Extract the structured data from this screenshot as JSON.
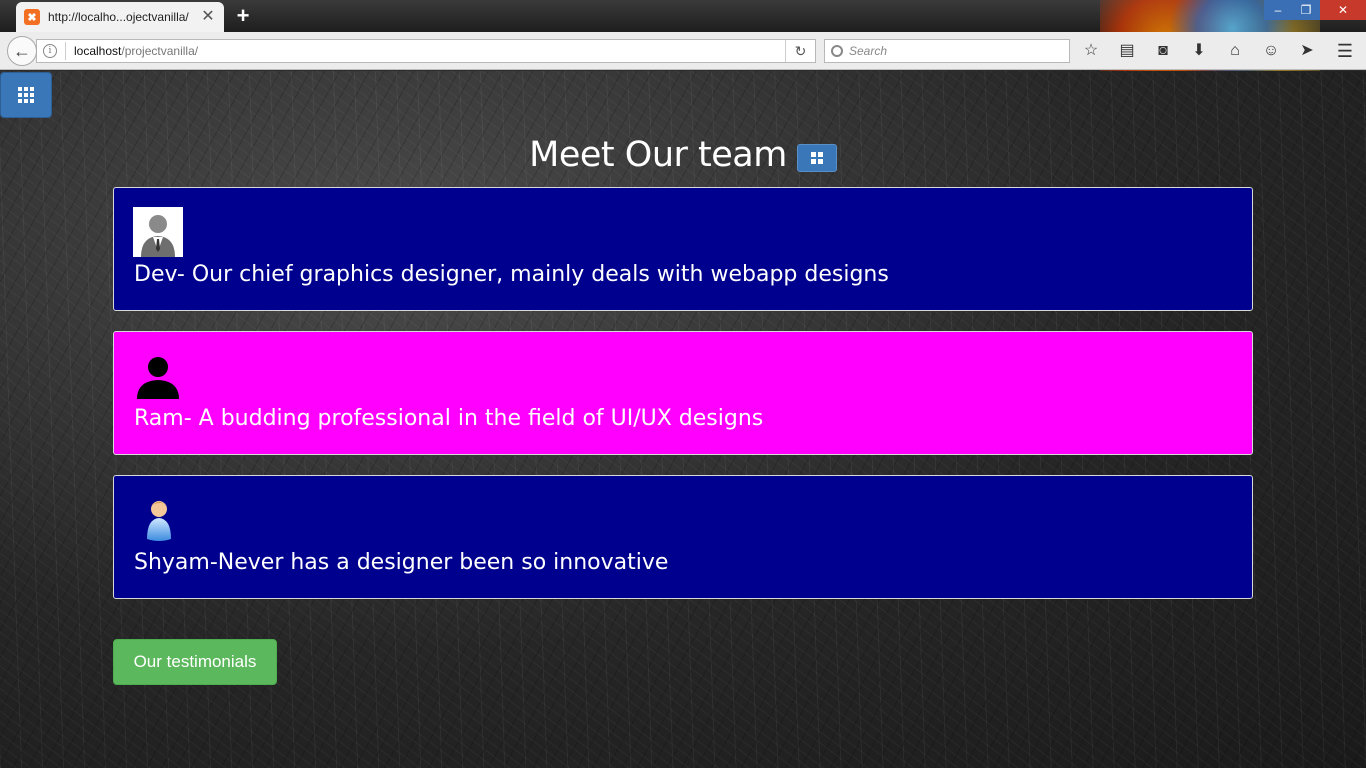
{
  "browser": {
    "tab_title": "http://localho...ojectvanilla/",
    "tab_close": "✕",
    "new_tab": "+",
    "url_host": "localhost",
    "url_path": "/projectvanilla/",
    "search_placeholder": "Search",
    "window_controls": [
      "–",
      "❐",
      "✕"
    ],
    "toolbar_icons": [
      "star-icon",
      "reading-list-icon",
      "pocket-icon",
      "download-icon",
      "home-icon",
      "smiley-icon",
      "send-icon",
      "menu-icon"
    ]
  },
  "page": {
    "heading": "Meet Our team",
    "team": [
      {
        "text": "Dev- Our chief graphics designer, mainly deals with webapp designs",
        "color": "#00008e",
        "avatar": "businessman-avatar-icon"
      },
      {
        "text": "Ram- A budding professional in the field of UI/UX designs",
        "color": "#ff00ff",
        "avatar": "person-silhouette-icon"
      },
      {
        "text": "Shyam-Never has a designer been so innovative",
        "color": "#00008e",
        "avatar": "user-avatar-icon"
      }
    ],
    "testimonials_button": "Our testimonials",
    "colors": {
      "primary_blue": "#3a77b8",
      "success_green": "#5cb85c"
    }
  }
}
